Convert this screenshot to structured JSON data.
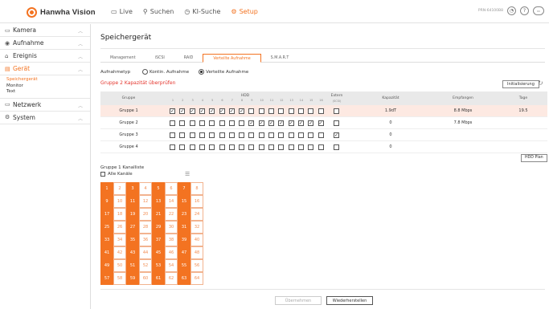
{
  "app": {
    "logo_text": "Hanwha Vision"
  },
  "nav": [
    {
      "icon": "monitor-icon",
      "glyph": "▭",
      "label": "Live",
      "active": false
    },
    {
      "icon": "search-icon",
      "glyph": "⚲",
      "label": "Suchen",
      "active": false
    },
    {
      "icon": "ai-search-icon",
      "glyph": "◷",
      "label": "KI-Suche",
      "active": false
    },
    {
      "icon": "gear-icon",
      "glyph": "⚙",
      "label": "Setup",
      "active": true
    }
  ],
  "top_right": {
    "device_id": "PRN-64100B8"
  },
  "sidebar": {
    "groups": [
      {
        "label": "Kamera",
        "glyph": "▭"
      },
      {
        "label": "Aufnahme",
        "glyph": "◉"
      },
      {
        "label": "Ereignis",
        "glyph": "⌂"
      },
      {
        "label": "Gerät",
        "glyph": "▤",
        "active": true,
        "subs": [
          "Speichergerät",
          "Monitor",
          "Text"
        ]
      },
      {
        "label": "Netzwerk",
        "glyph": "▭"
      },
      {
        "label": "System",
        "glyph": "⚙"
      }
    ]
  },
  "page": {
    "title": "Speichergerät",
    "tabs": [
      "Management",
      "iSCSI",
      "RAID",
      "Verteilte Aufnahme",
      "S.M.A.R.T"
    ],
    "active_tab": 3,
    "radio_label": "Aufnahmetyp",
    "radio_opts": [
      "Kontin. Aufnahme",
      "Verteilte Aufnahme"
    ],
    "radio_selected": 1,
    "warning": "Gruppe 2 Kapazität überprüfen",
    "init_button": "Initialisierung",
    "hdd_plan_button": "HDD Plan",
    "apply_button": "Übernehmen",
    "restore_button": "Wiederherstellen"
  },
  "table": {
    "headers": {
      "group": "Gruppe",
      "hdd": "HDD",
      "extern": "Extern",
      "extern_sub": "(SCSI)",
      "capacity": "Kapazität",
      "received": "Empfangen",
      "days": "Tage"
    },
    "hdd_numbers": [
      "1",
      "2",
      "3",
      "4",
      "5",
      "6",
      "7",
      "8",
      "9",
      "10",
      "11",
      "12",
      "13",
      "14",
      "15",
      "16"
    ],
    "rows": [
      {
        "group": "Gruppe 1",
        "checks": [
          1,
          1,
          1,
          1,
          1,
          1,
          1,
          1,
          0,
          0,
          0,
          0,
          0,
          0,
          0,
          0
        ],
        "extern": 0,
        "capacity": "1.9dT",
        "received": "8.8 Mbps",
        "days": "19.5",
        "selected": true
      },
      {
        "group": "Gruppe 2",
        "checks": [
          0,
          0,
          0,
          0,
          0,
          0,
          0,
          0,
          1,
          1,
          1,
          1,
          1,
          1,
          1,
          1
        ],
        "extern": 0,
        "capacity": "0",
        "received": "7.8 Mbps",
        "days": "",
        "selected": false
      },
      {
        "group": "Gruppe 3",
        "checks": [
          0,
          0,
          0,
          0,
          0,
          0,
          0,
          0,
          0,
          0,
          0,
          0,
          0,
          0,
          0,
          0
        ],
        "extern": 1,
        "capacity": "0",
        "received": "",
        "days": "",
        "selected": false
      },
      {
        "group": "Gruppe 4",
        "checks": [
          0,
          0,
          0,
          0,
          0,
          0,
          0,
          0,
          0,
          0,
          0,
          0,
          0,
          0,
          0,
          0
        ],
        "extern": 0,
        "capacity": "0",
        "received": "",
        "days": "",
        "selected": false
      }
    ]
  },
  "channel_list": {
    "title": "Gruppe 1 Kanalliste",
    "all_label": "Alle Kanäle",
    "on_columns": [
      0,
      2,
      4,
      6
    ]
  },
  "colors": {
    "accent": "#f37321",
    "warning": "#e4352d"
  }
}
